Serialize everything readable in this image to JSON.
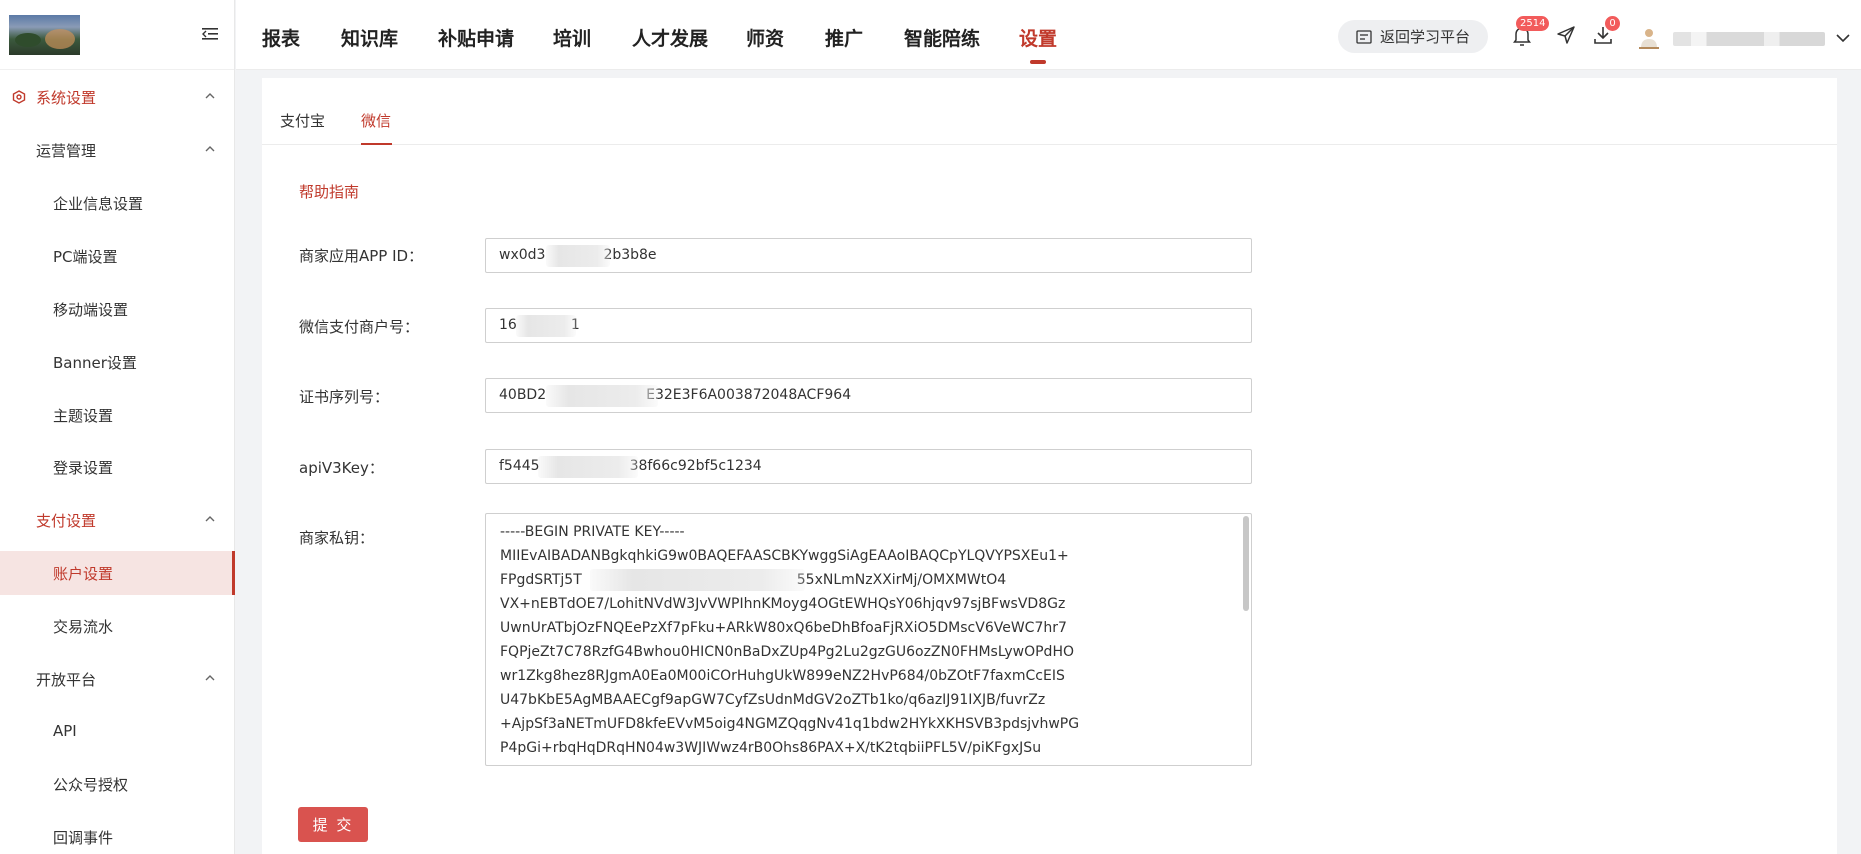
{
  "topnav": {
    "items": [
      {
        "label": "报表"
      },
      {
        "label": "知识库"
      },
      {
        "label": "补贴申请"
      },
      {
        "label": "培训"
      },
      {
        "label": "人才发展"
      },
      {
        "label": "师资"
      },
      {
        "label": "推广"
      },
      {
        "label": "智能陪练"
      },
      {
        "label": "设置",
        "active": true
      }
    ],
    "return_label": "返回学习平台",
    "notification_count": "2514",
    "download_count": "0"
  },
  "sidebar": {
    "section": "系统设置",
    "groups": [
      {
        "label": "运营管理",
        "items": [
          "企业信息设置",
          "PC端设置",
          "移动端设置",
          "Banner设置",
          "主题设置",
          "登录设置"
        ]
      },
      {
        "label": "支付设置",
        "items": [
          "账户设置",
          "交易流水"
        ]
      },
      {
        "label": "开放平台",
        "items": [
          "API",
          "公众号授权",
          "回调事件"
        ]
      }
    ],
    "active_item": "账户设置"
  },
  "tabs": [
    "支付宝",
    "微信"
  ],
  "active_tab": "微信",
  "help_link": "帮助指南",
  "form": {
    "app_id": {
      "label": "商家应用APP ID：",
      "value_start": "wx0d3",
      "value_end": "2b3b8e"
    },
    "merchant_no": {
      "label": "微信支付商户号：",
      "value_start": "16",
      "value_end": "1"
    },
    "cert_serial": {
      "label": "证书序列号：",
      "value_start": "40BD2",
      "value_end": "E32E3F6A003872048ACF964"
    },
    "api_v3_key": {
      "label": "apiV3Key：",
      "value_start": "f5445",
      "value_end": "38f66c92bf5c1234"
    },
    "private_key": {
      "label": "商家私钥：",
      "lines": [
        "-----BEGIN PRIVATE KEY-----",
        "MIIEvAIBADANBgkqhkiG9w0BAQEFAASCBKYwggSiAgEAAoIBAQCpYLQVYPSXEu1+",
        "FPgdSRTj5T",
        "VX+nEBTdOE7/LohitNVdW3JvVWPIhnKMoyg4OGtEWHQsY06hjqv97sjBFwsVD8Gz",
        "UwnUrATbjOzFNQEePzXf7pFku+ARkW80xQ6beDhBfoaFjRXiO5DMscV6VeWC7hr7",
        "FQPjeZt7C78RzfG4Bwhou0HICN0nBaDxZUp4Pg2Lu2gzGU6ozZN0FHMsLywOPdHO",
        "wr1Zkg8hez8RJgmA0Ea0M00iCOrHuhgUkW899eNZ2HvP684/0bZOtF7faxmCcEIS",
        "U47bKbE5AgMBAAECgf9apGW7CyfZsUdnMdGV2oZTb1ko/q6azIJ91IXJB/fuvrZz",
        "+AjpSf3aNETmUFD8kfeEVvM5oig4NGMZQqgNv41q1bdw2HYkXKHSVB3pdsjvhwPG",
        "P4pGi+rbqHqDRqHN04w3WJIWwz4rB0Ohs86PAX+X/tK2tqbiiPFL5V/piKFgxJSu"
      ],
      "line3_tail": "55xNLmNzXXirMj/OMXMWtO4"
    }
  },
  "submit_label": "提 交"
}
